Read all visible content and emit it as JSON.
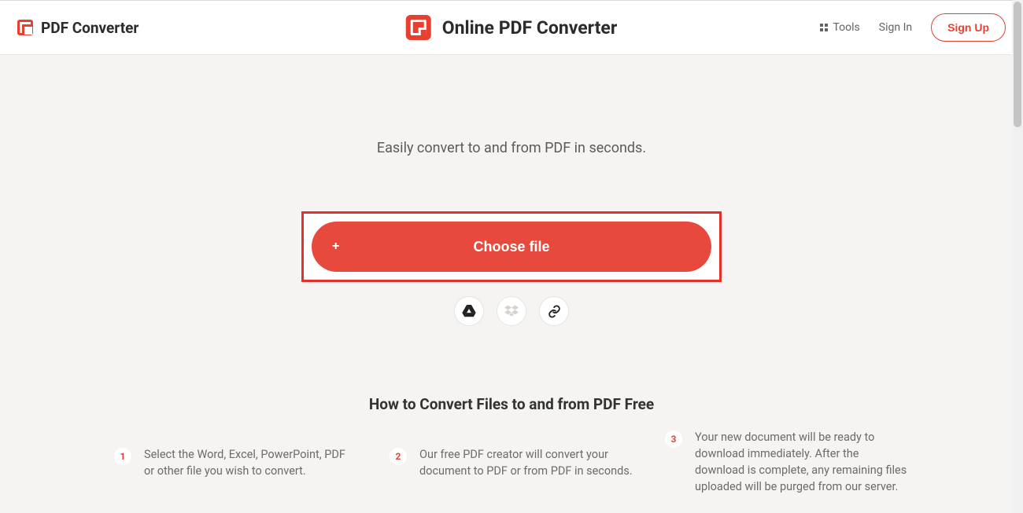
{
  "header": {
    "brand_left": "PDF Converter",
    "brand_center": "Online PDF Converter",
    "tools": "Tools",
    "signin": "Sign In",
    "signup": "Sign Up"
  },
  "main": {
    "subtitle": "Easily convert to and from PDF in seconds.",
    "choose_label": "Choose file",
    "plus": "+"
  },
  "howto": {
    "title": "How to Convert Files to and from PDF Free",
    "steps": [
      {
        "num": "1",
        "text": "Select the Word, Excel, PowerPoint, PDF or other file you wish to convert."
      },
      {
        "num": "2",
        "text": "Our free PDF creator will convert your document to PDF or from PDF in seconds."
      },
      {
        "num": "3",
        "text": "Your new document will be ready to download immediately. After the download is complete, any remaining files uploaded will be purged from our server."
      }
    ]
  },
  "colors": {
    "accent": "#e74033"
  }
}
